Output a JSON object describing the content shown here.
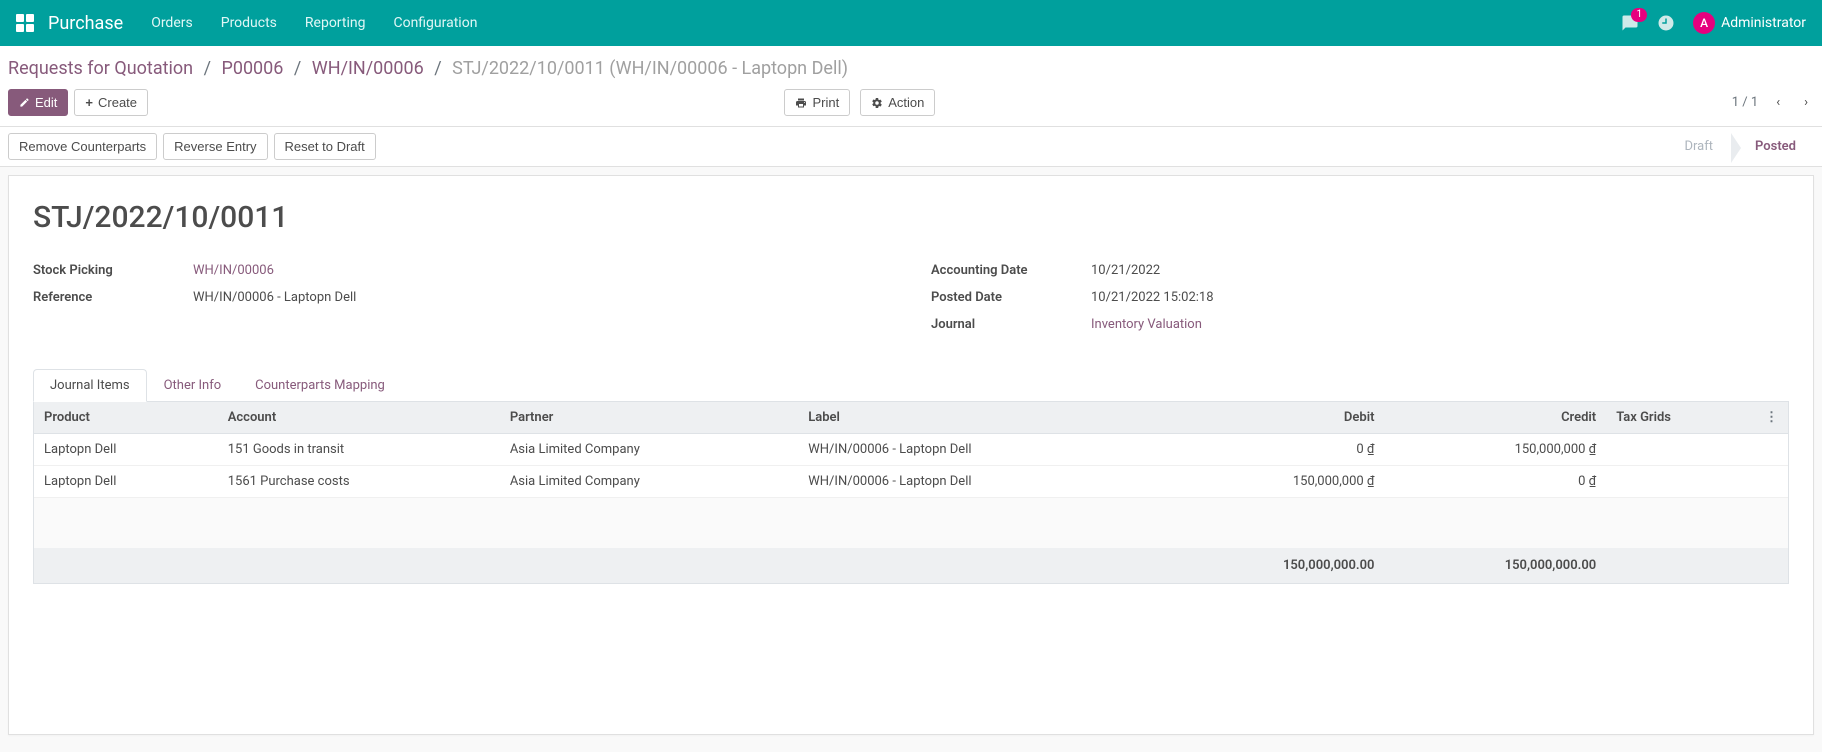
{
  "navbar": {
    "brand": "Purchase",
    "menu": [
      "Orders",
      "Products",
      "Reporting",
      "Configuration"
    ],
    "messages_badge": "1",
    "user_initial": "A",
    "user_name": "Administrator"
  },
  "breadcrumb": {
    "items": [
      "Requests for Quotation",
      "P00006",
      "WH/IN/00006"
    ],
    "active": "STJ/2022/10/0011 (WH/IN/00006 - Laptopn Dell)"
  },
  "buttons": {
    "edit": "Edit",
    "create": "Create",
    "print": "Print",
    "action": "Action",
    "remove_counterparts": "Remove Counterparts",
    "reverse_entry": "Reverse Entry",
    "reset_draft": "Reset to Draft"
  },
  "pager": {
    "text": "1 / 1"
  },
  "status": {
    "draft": "Draft",
    "posted": "Posted"
  },
  "record": {
    "title": "STJ/2022/10/0011",
    "left": {
      "stock_picking_label": "Stock Picking",
      "stock_picking_value": "WH/IN/00006",
      "reference_label": "Reference",
      "reference_value": "WH/IN/00006 - Laptopn Dell"
    },
    "right": {
      "accounting_date_label": "Accounting Date",
      "accounting_date_value": "10/21/2022",
      "posted_date_label": "Posted Date",
      "posted_date_value": "10/21/2022 15:02:18",
      "journal_label": "Journal",
      "journal_value": "Inventory Valuation"
    }
  },
  "tabs": [
    "Journal Items",
    "Other Info",
    "Counterparts Mapping"
  ],
  "table": {
    "headers": {
      "product": "Product",
      "account": "Account",
      "partner": "Partner",
      "label": "Label",
      "debit": "Debit",
      "credit": "Credit",
      "tax_grids": "Tax Grids"
    },
    "rows": [
      {
        "product": "Laptopn Dell",
        "account": "151 Goods in transit",
        "partner": "Asia Limited Company",
        "label": "WH/IN/00006 - Laptopn Dell",
        "debit": "0 ₫",
        "credit": "150,000,000 ₫",
        "tax_grids": ""
      },
      {
        "product": "Laptopn Dell",
        "account": "1561 Purchase costs",
        "partner": "Asia Limited Company",
        "label": "WH/IN/00006 - Laptopn Dell",
        "debit": "150,000,000 ₫",
        "credit": "0 ₫",
        "tax_grids": ""
      }
    ],
    "totals": {
      "debit": "150,000,000.00",
      "credit": "150,000,000.00"
    }
  }
}
